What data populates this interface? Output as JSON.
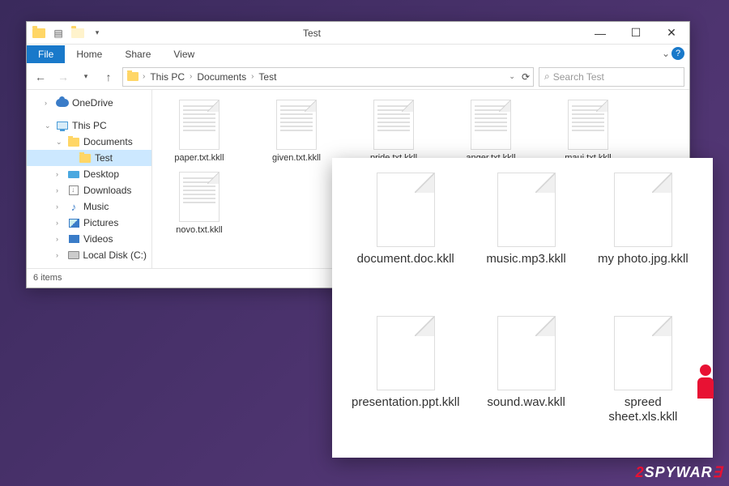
{
  "window": {
    "title": "Test",
    "controls": {
      "minimize": "—",
      "maximize": "☐",
      "close": "✕"
    }
  },
  "ribbon": {
    "file": "File",
    "home": "Home",
    "share": "Share",
    "view": "View"
  },
  "breadcrumb": {
    "root_icon": "folder",
    "parts": [
      "This PC",
      "Documents",
      "Test"
    ]
  },
  "search": {
    "placeholder": "Search Test"
  },
  "sidebar": {
    "items": [
      {
        "label": "OneDrive",
        "icon": "cloud",
        "indent": 1,
        "expand": ">"
      },
      {
        "label": "This PC",
        "icon": "monitor",
        "indent": 1,
        "expand": "v"
      },
      {
        "label": "Documents",
        "icon": "folder",
        "indent": 2,
        "expand": "v"
      },
      {
        "label": "Test",
        "icon": "folder",
        "indent": 3,
        "selected": true
      },
      {
        "label": "Desktop",
        "icon": "desktop",
        "indent": 2,
        "expand": ">"
      },
      {
        "label": "Downloads",
        "icon": "down",
        "indent": 2,
        "expand": ">"
      },
      {
        "label": "Music",
        "icon": "music",
        "indent": 2,
        "expand": ">"
      },
      {
        "label": "Pictures",
        "icon": "pic",
        "indent": 2,
        "expand": ">"
      },
      {
        "label": "Videos",
        "icon": "video",
        "indent": 2,
        "expand": ">"
      },
      {
        "label": "Local Disk (C:)",
        "icon": "disk",
        "indent": 2,
        "expand": ">"
      }
    ]
  },
  "files": [
    {
      "label": "paper.txt.kkll"
    },
    {
      "label": "given.txt.kkll"
    },
    {
      "label": "pride.txt.kkll"
    },
    {
      "label": "anger.txt.kkll"
    },
    {
      "label": "maui.txt.kkll"
    },
    {
      "label": "novo.txt.kkll"
    }
  ],
  "status": {
    "count": "6 items"
  },
  "overlay_files": [
    {
      "label": "document.doc.kkll"
    },
    {
      "label": "music.mp3.kkll"
    },
    {
      "label": "my photo.jpg.kkll"
    },
    {
      "label": "presentation.ppt.kkll"
    },
    {
      "label": "sound.wav.kkll"
    },
    {
      "label": "spreed sheet.xls.kkll"
    }
  ],
  "watermark": {
    "prefix": "2",
    "text": "SPYWAR",
    "suffix": "∃"
  }
}
